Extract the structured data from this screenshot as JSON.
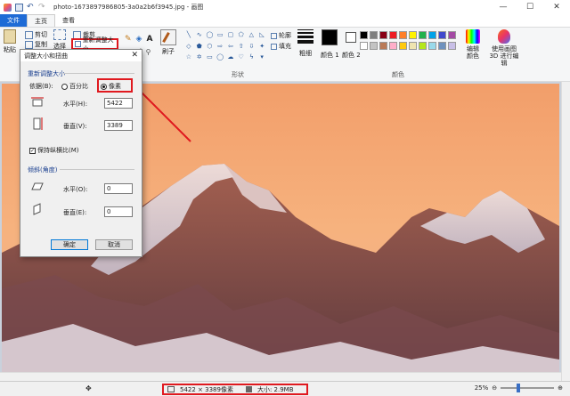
{
  "window": {
    "title": "photo-1673897986805-3a0a2b6f3945.jpg - 画图",
    "minimize": "—",
    "maximize": "☐",
    "close": "✕"
  },
  "tabs": {
    "file": "文件",
    "home": "主页",
    "view": "查看"
  },
  "ribbon": {
    "paste": "粘贴",
    "cut": "剪切",
    "copy": "复制",
    "select": "选择",
    "crop": "裁剪",
    "resize": "重新调整大小",
    "rotate": "旋转",
    "brush": "刷子",
    "outline": "轮廓",
    "fill": "填充",
    "shapes_label": "形状",
    "size": "粗细",
    "color1": "颜色 1",
    "color2": "颜色 2",
    "colors_label": "颜色",
    "edit_colors": "编辑颜色",
    "paint3d": "使用画图 3D 进行编辑",
    "palette": [
      "#000000",
      "#7f7f7f",
      "#880015",
      "#ed1c24",
      "#ff7f27",
      "#fff200",
      "#22b14c",
      "#00a2e8",
      "#3f48cc",
      "#a349a4",
      "#ffffff",
      "#c3c3c3",
      "#b97a57",
      "#ffaec9",
      "#ffc90e",
      "#efe4b0",
      "#b5e61d",
      "#99d9ea",
      "#7092be",
      "#c8bfe7"
    ]
  },
  "dialog": {
    "title": "调整大小和扭曲",
    "close": "✕",
    "resize_section": "重新调整大小",
    "by_label": "依据(B):",
    "percent": "百分比",
    "pixels": "像素",
    "horizontal_label": "水平(H):",
    "horizontal_value": "5422",
    "vertical_label": "垂直(V):",
    "vertical_value": "3389",
    "keep_ratio": "保持纵横比(M)",
    "skew_section": "倾斜(角度)",
    "skew_h_label": "水平(O):",
    "skew_h_value": "0",
    "skew_v_label": "垂直(E):",
    "skew_v_value": "0",
    "ok": "确定",
    "cancel": "取消"
  },
  "status": {
    "dimensions": "5422 × 3389像素",
    "size": "大小: 2.9MB",
    "zoom": "25%"
  },
  "colors": {
    "accent_red": "#e0191f",
    "file_tab": "#1e6bd6"
  }
}
